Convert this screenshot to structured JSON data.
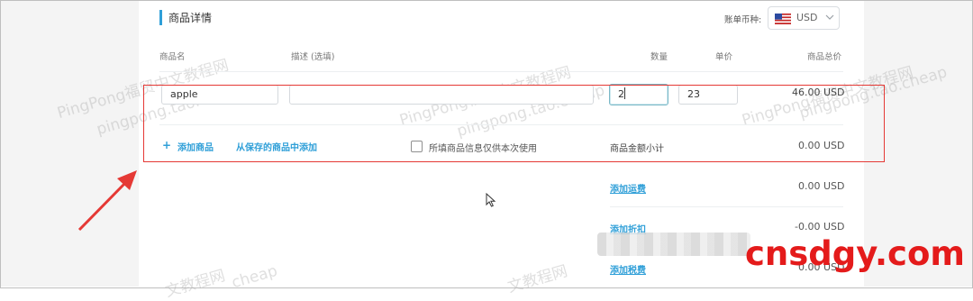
{
  "section": {
    "title": "商品详情"
  },
  "currency": {
    "label": "账单币种:",
    "code": "USD",
    "flag_icon": "us-flag-icon"
  },
  "columns": {
    "name": "商品名",
    "description": "描述 (选填)",
    "quantity": "数量",
    "unit_price": "单价",
    "total": "商品总价"
  },
  "item_row": {
    "name_value": "apple",
    "description_value": "",
    "quantity_value": "2",
    "unit_price_value": "23",
    "total_value": "46.00 USD"
  },
  "actions": {
    "add_item": "添加商品",
    "add_from_saved": "从保存的商品中添加",
    "one_time_use_label": "所填商品信息仅供本次使用",
    "one_time_use_checked": false
  },
  "summary": {
    "subtotal_label": "商品金额小计",
    "subtotal_value": "0.00 USD",
    "shipping_label": "添加运费",
    "shipping_value": "0.00 USD",
    "discount_label": "添加折扣",
    "discount_value": "-0.00 USD",
    "tax_label": "添加税费",
    "tax_value": "0.00 USD"
  },
  "watermarks": {
    "line_a": "PingPong福贸中文教程网",
    "line_b": "pingpong.tao.cheap",
    "line_c": "文教程网",
    "line_d": "cheap"
  },
  "brand": {
    "text": "cnsdgy.com"
  },
  "colors": {
    "accent": "#2f9fd8",
    "annotation_red": "#e53935",
    "brand_red": "#e41b1b"
  }
}
